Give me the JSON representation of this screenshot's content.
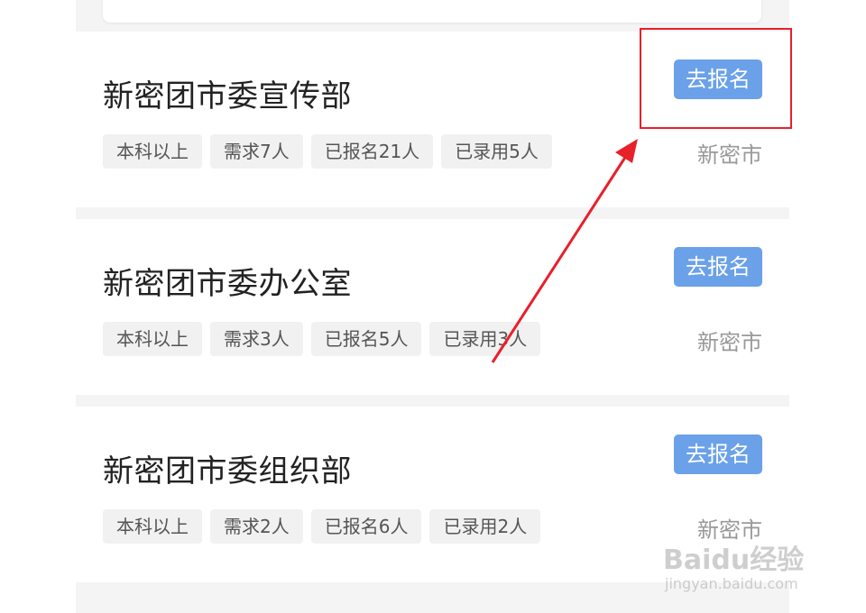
{
  "jobs": [
    {
      "title": "新密团市委宣传部",
      "apply_label": "去报名",
      "tags": [
        "本科以上",
        "需求7人",
        "已报名21人",
        "已录用5人"
      ],
      "location": "新密市"
    },
    {
      "title": "新密团市委办公室",
      "apply_label": "去报名",
      "tags": [
        "本科以上",
        "需求3人",
        "已报名5人",
        "已录用3人"
      ],
      "location": "新密市"
    },
    {
      "title": "新密团市委组织部",
      "apply_label": "去报名",
      "tags": [
        "本科以上",
        "需求2人",
        "已报名6人",
        "已录用2人"
      ],
      "location": "新密市"
    }
  ],
  "watermark": {
    "brand": "Baidu经验",
    "url": "jingyan.baidu.com"
  },
  "colors": {
    "accent": "#6aa1e8",
    "annotation": "#e8202a",
    "background": "#f4f4f4"
  }
}
